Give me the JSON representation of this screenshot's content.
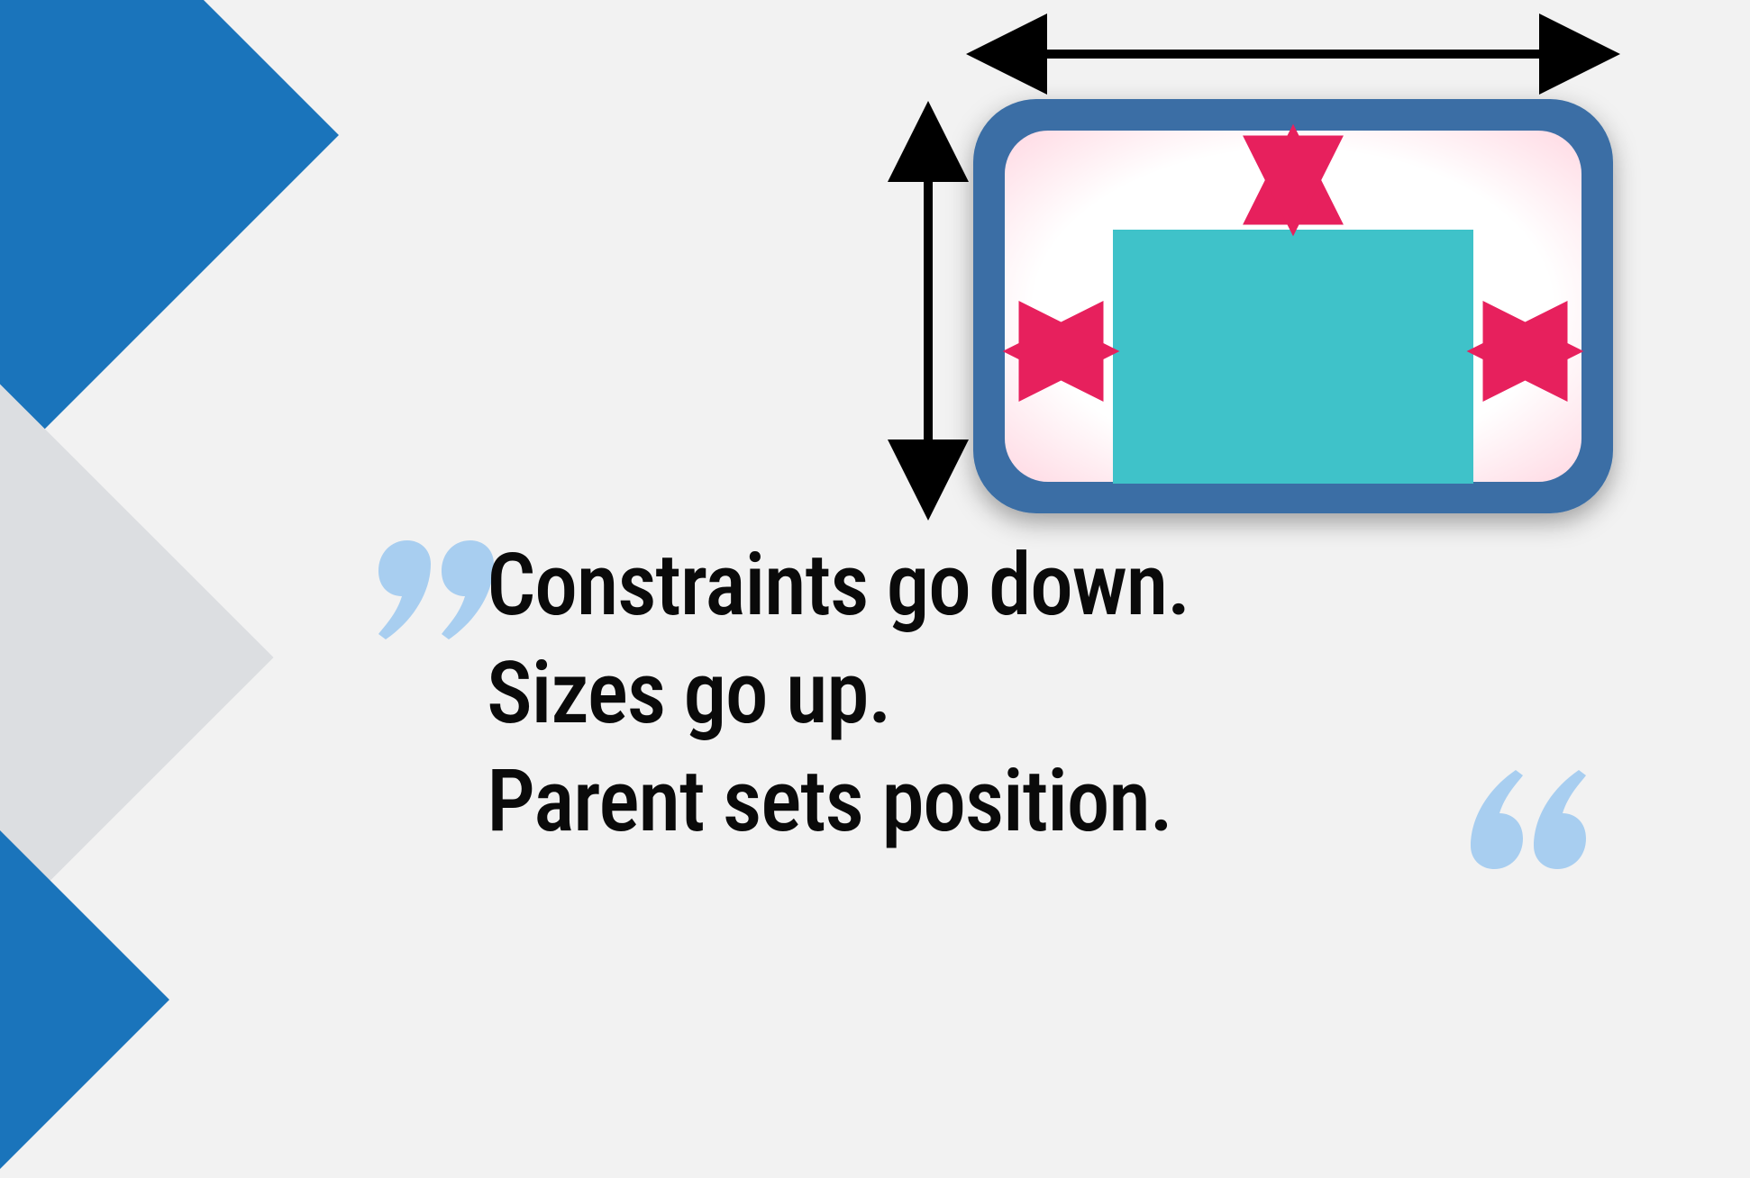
{
  "quote": {
    "line1": "Constraints go down.",
    "line2": "Sizes go up.",
    "line3": "Parent sets position."
  },
  "colors": {
    "bg": "#f2f2f2",
    "brand_dark": "#1a74bb",
    "brand_light": "#3eb0ef",
    "grey": "#dcdee1",
    "frame": "#3a6ea5",
    "child": "#3fc2c9",
    "arrow_pink": "#e7205d",
    "arrow_black": "#000000",
    "quote_accent": "#a8cef0"
  },
  "diagram": {
    "description": "Parent-child layout constraint illustration",
    "outer_arrows": "parent constraints (black, down/across)",
    "inner_arrows": "child margins/gaps (pink)",
    "child_shape": "teal rectangle inside rounded parent frame"
  }
}
